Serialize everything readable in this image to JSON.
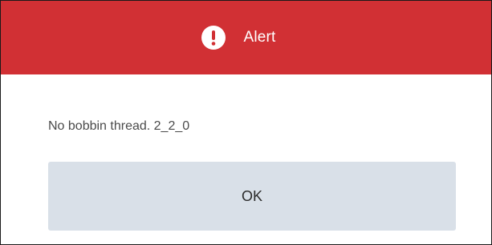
{
  "dialog": {
    "title": "Alert",
    "icon": "exclamation-icon",
    "message": "No bobbin thread. 2_2_0",
    "ok_label": "OK"
  },
  "colors": {
    "header_background": "#d13034",
    "header_text": "#ffffff",
    "button_background": "#d9e0e8",
    "message_text": "#4a4a4a"
  }
}
